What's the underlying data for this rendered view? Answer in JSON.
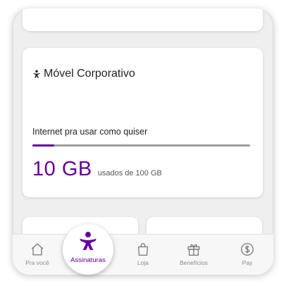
{
  "plan_card": {
    "title": "Móvel Corporativo",
    "usage_label": "Internet pra usar como quiser",
    "usage_value": "10 GB",
    "usage_sub": "usados de 100 GB",
    "usage_fraction": 0.1
  },
  "nav": {
    "items": [
      {
        "label": "Pra você",
        "icon": "home-icon"
      },
      {
        "label": "Assinaturas",
        "icon": "vivo-person-icon",
        "active": true
      },
      {
        "label": "Loja",
        "icon": "shopping-bag-icon"
      },
      {
        "label": "Benefícios",
        "icon": "gift-icon"
      },
      {
        "label": "Pay",
        "icon": "dollar-circle-icon"
      }
    ]
  },
  "colors": {
    "brand": "#660099",
    "track": "#9e9e9e",
    "inactive_text": "#8a8a8a"
  }
}
